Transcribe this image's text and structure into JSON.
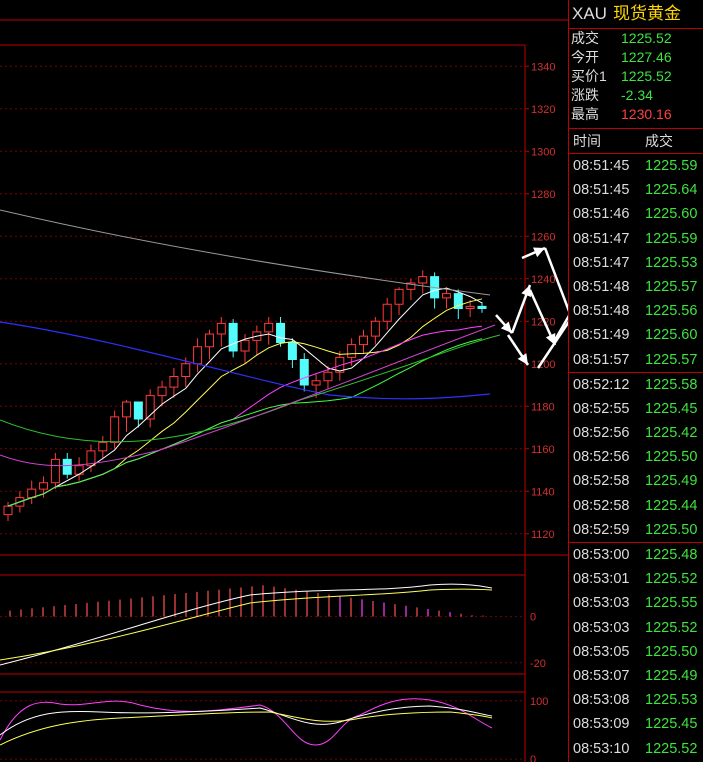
{
  "header": {
    "symbol": "XAU",
    "name": "现货黄金"
  },
  "quote": [
    {
      "label": "成交",
      "value": "1225.52",
      "color": "dn"
    },
    {
      "label": "今开",
      "value": "1227.46",
      "color": "dn"
    },
    {
      "label": "买价1",
      "value": "1225.52",
      "color": "dn"
    },
    {
      "label": "涨跌",
      "value": "-2.34",
      "color": "dn"
    },
    {
      "label": "最高",
      "value": "1230.16",
      "color": "up"
    }
  ],
  "ticks_header": {
    "time": "时间",
    "price": "成交"
  },
  "ticks": [
    {
      "time": "08:51:45",
      "price": "1225.59"
    },
    {
      "time": "08:51:45",
      "price": "1225.64"
    },
    {
      "time": "08:51:46",
      "price": "1225.60"
    },
    {
      "time": "08:51:47",
      "price": "1225.59"
    },
    {
      "time": "08:51:47",
      "price": "1225.53"
    },
    {
      "time": "08:51:48",
      "price": "1225.57"
    },
    {
      "time": "08:51:48",
      "price": "1225.56"
    },
    {
      "time": "08:51:49",
      "price": "1225.60"
    },
    {
      "time": "08:51:57",
      "price": "1225.57"
    },
    {
      "time": "08:52:12",
      "price": "1225.58"
    },
    {
      "time": "08:52:55",
      "price": "1225.45"
    },
    {
      "time": "08:52:56",
      "price": "1225.42"
    },
    {
      "time": "08:52:56",
      "price": "1225.50"
    },
    {
      "time": "08:52:58",
      "price": "1225.49"
    },
    {
      "time": "08:52:58",
      "price": "1225.44"
    },
    {
      "time": "08:52:59",
      "price": "1225.50"
    },
    {
      "time": "08:53:00",
      "price": "1225.48"
    },
    {
      "time": "08:53:01",
      "price": "1225.52"
    },
    {
      "time": "08:53:03",
      "price": "1225.55"
    },
    {
      "time": "08:53:03",
      "price": "1225.52"
    },
    {
      "time": "08:53:05",
      "price": "1225.50"
    },
    {
      "time": "08:53:07",
      "price": "1225.49"
    },
    {
      "time": "08:53:08",
      "price": "1225.53"
    },
    {
      "time": "08:53:09",
      "price": "1225.45"
    },
    {
      "time": "08:53:10",
      "price": "1225.52"
    }
  ],
  "chart_data": {
    "type": "candlestick",
    "price_axis": {
      "ticks": [
        1120,
        1140,
        1160,
        1180,
        1200,
        1220,
        1240,
        1260,
        1280,
        1300,
        1320,
        1340
      ],
      "range": [
        1110,
        1350
      ]
    },
    "macd_axis": {
      "ticks": [
        0,
        -20
      ],
      "range": [
        -24,
        18
      ]
    },
    "kdj_axis": {
      "ticks": [
        100,
        0
      ],
      "range": [
        -5,
        115
      ]
    },
    "candles": [
      [
        1129,
        1135,
        1126,
        1133
      ],
      [
        1133,
        1140,
        1130,
        1137
      ],
      [
        1137,
        1145,
        1134,
        1141
      ],
      [
        1141,
        1147,
        1137,
        1144
      ],
      [
        1144,
        1158,
        1141,
        1155
      ],
      [
        1155,
        1158,
        1146,
        1148
      ],
      [
        1148,
        1156,
        1145,
        1152
      ],
      [
        1152,
        1162,
        1149,
        1159
      ],
      [
        1159,
        1166,
        1155,
        1163
      ],
      [
        1163,
        1178,
        1160,
        1175
      ],
      [
        1175,
        1183,
        1168,
        1182
      ],
      [
        1182,
        1181,
        1170,
        1174
      ],
      [
        1174,
        1188,
        1170,
        1185
      ],
      [
        1185,
        1192,
        1180,
        1189
      ],
      [
        1189,
        1198,
        1184,
        1194
      ],
      [
        1194,
        1203,
        1189,
        1200
      ],
      [
        1200,
        1212,
        1196,
        1208
      ],
      [
        1208,
        1216,
        1202,
        1214
      ],
      [
        1214,
        1222,
        1208,
        1219
      ],
      [
        1219,
        1221,
        1203,
        1206
      ],
      [
        1206,
        1214,
        1200,
        1211
      ],
      [
        1211,
        1218,
        1204,
        1215
      ],
      [
        1215,
        1222,
        1209,
        1219
      ],
      [
        1219,
        1222,
        1208,
        1210
      ],
      [
        1210,
        1212,
        1198,
        1202
      ],
      [
        1202,
        1205,
        1187,
        1190
      ],
      [
        1190,
        1195,
        1184,
        1192
      ],
      [
        1192,
        1199,
        1188,
        1196
      ],
      [
        1196,
        1206,
        1192,
        1203
      ],
      [
        1203,
        1212,
        1199,
        1209
      ],
      [
        1209,
        1216,
        1205,
        1213
      ],
      [
        1213,
        1222,
        1209,
        1220
      ],
      [
        1220,
        1231,
        1216,
        1228
      ],
      [
        1228,
        1236,
        1223,
        1235
      ],
      [
        1235,
        1240,
        1230,
        1238
      ],
      [
        1238,
        1244,
        1233,
        1241
      ],
      [
        1241,
        1243,
        1226,
        1231
      ],
      [
        1231,
        1236,
        1226,
        1233
      ],
      [
        1233,
        1235,
        1221,
        1226
      ],
      [
        1226,
        1230,
        1222,
        1227
      ],
      [
        1227,
        1229,
        1224,
        1226
      ]
    ],
    "annotation_arrows": "white zig-zag arrows drawn over right edge"
  }
}
